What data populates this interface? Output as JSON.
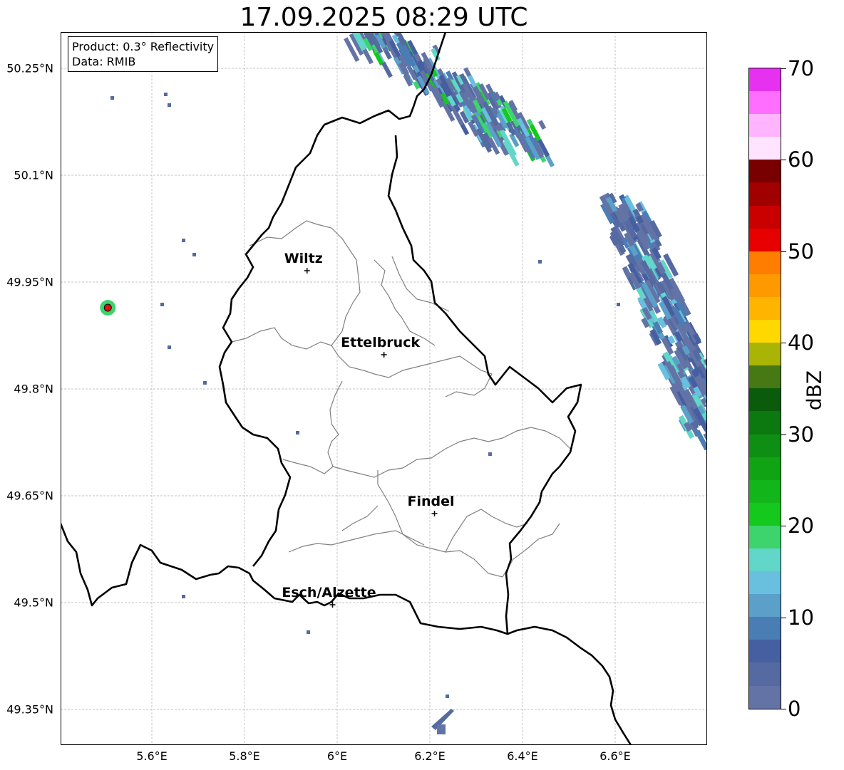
{
  "title": "17.09.2025 08:29 UTC",
  "infobox": {
    "product": "Product: 0.3° Reflectivity",
    "data": "Data: RMIB"
  },
  "lat_labels": [
    "50.25°N",
    "50.1°N",
    "49.95°N",
    "49.8°N",
    "49.65°N",
    "49.5°N",
    "49.35°N"
  ],
  "lon_labels": [
    "5.6°E",
    "5.8°E",
    "6°E",
    "6.2°E",
    "6.4°E",
    "6.6°E"
  ],
  "cities": [
    {
      "name": "Wiltz",
      "lon": 5.935,
      "lat": 49.966
    },
    {
      "name": "Ettelbruck",
      "lon": 6.101,
      "lat": 49.848
    },
    {
      "name": "Findel",
      "lon": 6.21,
      "lat": 49.625
    },
    {
      "name": "Esch/Alzette",
      "lon": 5.99,
      "lat": 49.497
    }
  ],
  "radar_site": {
    "lon": 5.505,
    "lat": 49.914,
    "color": "#e01010"
  },
  "colorbar": {
    "label": "dBZ",
    "ticks": [
      "0",
      "10",
      "20",
      "30",
      "40",
      "50",
      "60",
      "70"
    ],
    "min": 0,
    "max": 70,
    "step": 2.5,
    "colors": [
      "#6473a6",
      "#546aa0",
      "#465fa0",
      "#4b7db5",
      "#5aa0c8",
      "#68c0de",
      "#62d6c8",
      "#3dd46e",
      "#14c81e",
      "#12b51a",
      "#10a414",
      "#0e8e12",
      "#0c7810",
      "#0a5c0c",
      "#467814",
      "#aab404",
      "#ffd800",
      "#ffb400",
      "#ff9900",
      "#ff7d00",
      "#e60000",
      "#c80000",
      "#a00000",
      "#780000",
      "#ffe4ff",
      "#ffb4ff",
      "#ff6eff",
      "#e632f0"
    ]
  },
  "map_colors": {
    "border": "#000000",
    "cantons": "#808080",
    "grid": "#b0b0b0"
  }
}
